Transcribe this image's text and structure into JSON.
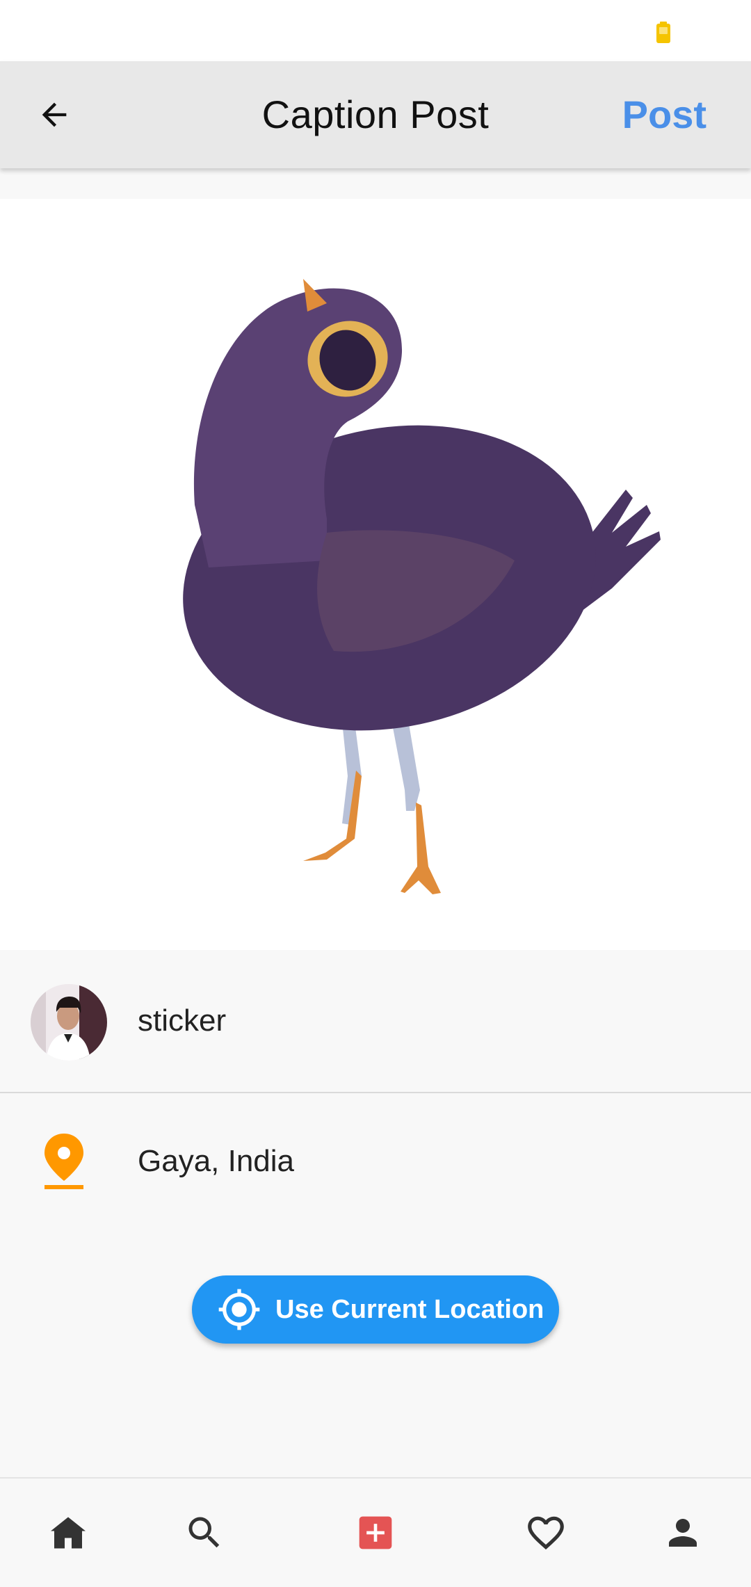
{
  "status_bar": {
    "battery_icon": "battery-icon",
    "battery_color": "#f5c400"
  },
  "app_bar": {
    "back_icon": "arrow-left-icon",
    "title": "Caption Post",
    "post_label": "Post",
    "post_color": "#4a8fe8"
  },
  "post_image": {
    "icon": "purple-bird-illustration"
  },
  "caption": {
    "avatar": "user-avatar",
    "text": "sticker"
  },
  "location": {
    "icon": "map-pin-icon",
    "icon_color": "#ff9800",
    "text": "Gaya, India"
  },
  "current_location_button": {
    "icon": "crosshair-icon",
    "label": "Use Current Location",
    "color": "#2196f3"
  },
  "bottom_nav": {
    "items": [
      {
        "icon": "home-icon"
      },
      {
        "icon": "search-icon"
      },
      {
        "icon": "add-post-icon",
        "color": "#e45454"
      },
      {
        "icon": "heart-icon"
      },
      {
        "icon": "person-icon"
      }
    ]
  }
}
